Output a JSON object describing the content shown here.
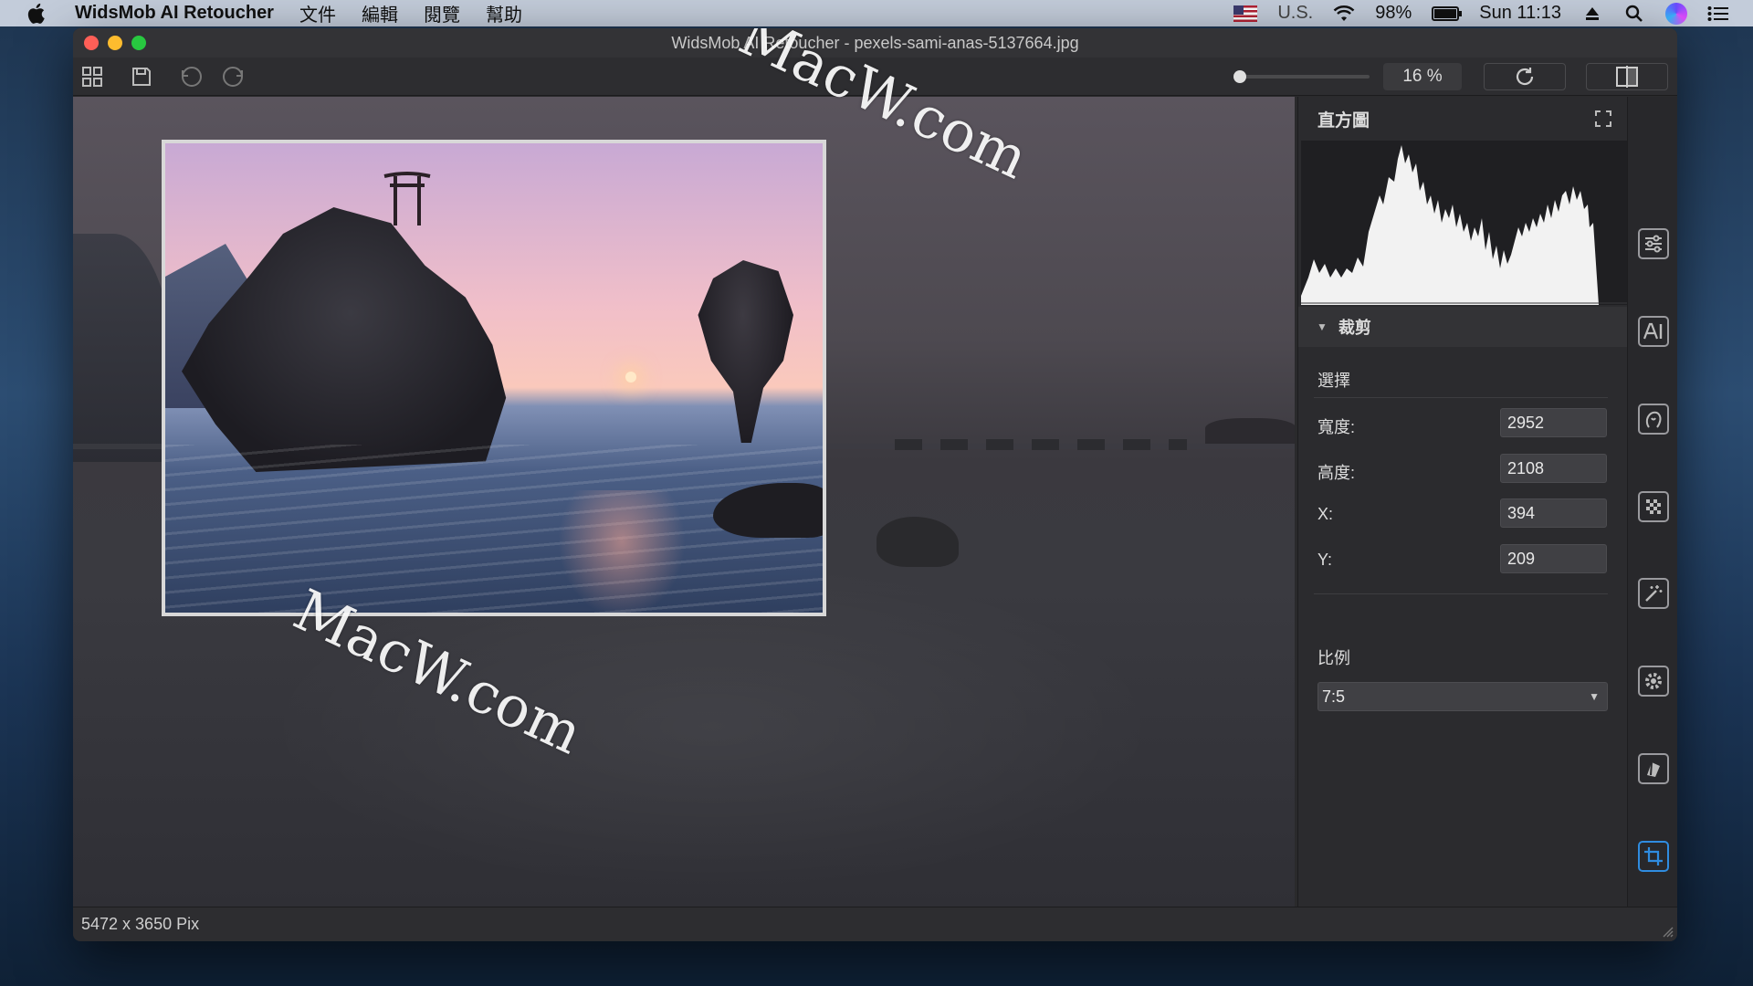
{
  "menubar": {
    "app_name": "WidsMob AI Retoucher",
    "menus": [
      "文件",
      "編輯",
      "閱覽",
      "幫助"
    ],
    "input_source": "U.S.",
    "battery": "98%",
    "battery_level": 0.98,
    "clock": "Sun 11:13"
  },
  "window": {
    "title": "WidsMob AI Retoucher - pexels-sami-anas-5137664.jpg"
  },
  "toolbar": {
    "zoom": "16 %",
    "zoom_level": 0.16
  },
  "panel": {
    "histogram_title": "直方圖",
    "crop_section_title": "裁剪",
    "select_label": "選擇",
    "width_label": "寬度:",
    "width_value": "2952",
    "height_label": "高度:",
    "height_value": "2108",
    "x_label": "X:",
    "x_value": "394",
    "y_label": "Y:",
    "y_value": "209",
    "ratio_label": "比例",
    "ratio_value": "7:5"
  },
  "status": {
    "dimensions": "5472 x 3650 Pix"
  },
  "watermark": {
    "text": "MacW.com"
  },
  "tools": [
    "adjust-icon",
    "ai-icon",
    "portrait-icon",
    "denoise-icon",
    "magic-wand-icon",
    "settings-icon",
    "filter-icon",
    "crop-icon"
  ],
  "colors": {
    "accent": "#2f8ce0",
    "close": "#ff5f57",
    "minimize": "#febc2e",
    "maximize": "#28c840"
  }
}
